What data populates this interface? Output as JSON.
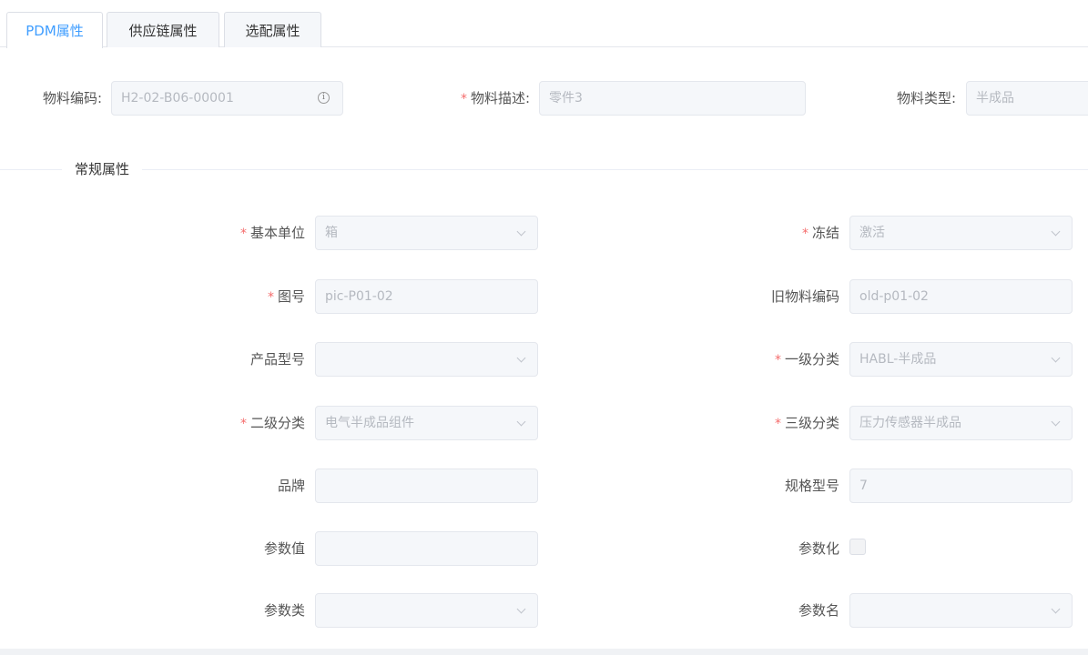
{
  "tabs": [
    {
      "label": "PDM属性",
      "active": true
    },
    {
      "label": "供应链属性",
      "active": false
    },
    {
      "label": "选配属性",
      "active": false
    }
  ],
  "header_fields": {
    "material_code": {
      "label": "物料编码:",
      "value": "H2-02-B06-00001"
    },
    "material_desc": {
      "label": "物料描述:",
      "value": "零件3",
      "required_mark": "*"
    },
    "material_type": {
      "label": "物料类型:",
      "value": "半成品"
    }
  },
  "section": {
    "title": "常规属性"
  },
  "fields": {
    "base_unit": {
      "label": "基本单位",
      "value": "箱",
      "required_mark": "*"
    },
    "freeze": {
      "label": "冻结",
      "value": "激活",
      "required_mark": "*"
    },
    "drawing_no": {
      "label": "图号",
      "value": "pic-P01-02",
      "required_mark": "*"
    },
    "old_code": {
      "label": "旧物料编码",
      "value": "old-p01-02"
    },
    "product_model": {
      "label": "产品型号",
      "value": ""
    },
    "level1": {
      "label": "一级分类",
      "value": "HABL-半成品",
      "required_mark": "*"
    },
    "level2": {
      "label": "二级分类",
      "value": "电气半成品组件",
      "required_mark": "*"
    },
    "level3": {
      "label": "三级分类",
      "value": "压力传感器半成品",
      "required_mark": "*"
    },
    "brand": {
      "label": "品牌",
      "value": ""
    },
    "spec": {
      "label": "规格型号",
      "value": "7"
    },
    "param_value": {
      "label": "参数值",
      "value": ""
    },
    "parameterized": {
      "label": "参数化",
      "checked": false
    },
    "param_class": {
      "label": "参数类",
      "value": ""
    },
    "param_name": {
      "label": "参数名",
      "value": ""
    }
  },
  "icons": {
    "info": "i"
  }
}
